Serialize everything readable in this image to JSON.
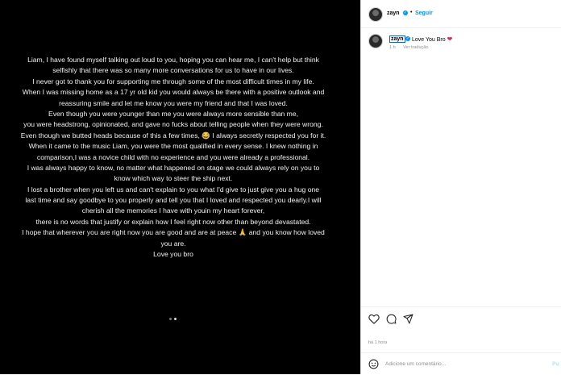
{
  "post": {
    "letter_lines": [
      "Liam, I have found myself talking out loud to you, hoping you can hear me, I can't help but think",
      "selfishly that there was so many more conversations for us to have in our lives.",
      "I never got to thank you for supporting me through some of the most difficult times in my life.",
      "When I was missing home as a 17 yr old kid you would always be there with a positive outlook and",
      "reassuring smile and let me know you were my friend and that I was loved.",
      "Even though you were younger than me you were always more sensible than me,",
      "you were headstrong, opinionated, and gave no fucks about telling people when they were wrong.",
      "Even though we butted heads because of this a few times, 😂 I always secretly respected you for it.",
      "When it came to the music Liam, you were the most qualified in every sense. I knew nothing in",
      "comparison,I was a novice child with no experience and you were already a professional.",
      "I was always happy to know, no matter what happened on stage we could always rely on you to",
      "know which way to steer the ship next.",
      "I lost a brother when you left us and can't explain to you what I'd give to just give you a hug one",
      "last time and say goodbye to you properly and tell you that I loved and respected you  dearly.I will",
      "cherish all the memories I have with youin my heart forever,",
      "there is no words that justify or explain how I feel right now other than beyond devastated.",
      "I hope that wherever you are right now you are good and are at peace 🙏 and you know how loved",
      "you are.",
      "Love you bro"
    ]
  },
  "header": {
    "username": "zayn",
    "separator": "•",
    "follow_label": "Seguir"
  },
  "comment": {
    "username": "zayn",
    "text": "Love You Bro",
    "heart": "❤",
    "time": "1 h",
    "translate_label": "Ver tradução"
  },
  "footer": {
    "time_label": "há 1 hora",
    "comment_placeholder": "Adicione um comentário...",
    "publish_label": "Pu"
  },
  "colors": {
    "accent": "#0095f6",
    "heart": "#e0245e",
    "image_bg": "#000000"
  },
  "icons": [
    "heart-icon",
    "comment-icon",
    "share-icon",
    "emoji-icon"
  ]
}
